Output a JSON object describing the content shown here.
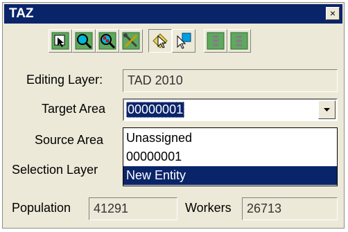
{
  "window": {
    "title": "TAZ",
    "close_symbol": "×"
  },
  "toolbar": {
    "buttons": [
      {
        "icon": "select-feature-icon"
      },
      {
        "icon": "zoom-in-icon"
      },
      {
        "icon": "zoom-layer-icon"
      },
      {
        "icon": "settings-tools-icon"
      },
      {
        "icon": "pointer-select-icon",
        "pressed": true
      },
      {
        "icon": "arrow-select-icon"
      },
      {
        "icon": "stack-up-icon"
      },
      {
        "icon": "stack-down-icon"
      }
    ]
  },
  "form": {
    "editing_layer_label": "Editing Layer:",
    "editing_layer_value": "TAD 2010",
    "target_area_label": "Target Area",
    "target_area_value": "00000001",
    "source_area_label": "Source Area",
    "selection_layer_label": "Selection Layer",
    "dropdown_options": [
      "Unassigned",
      "00000001",
      "New Entity"
    ],
    "dropdown_selected": "New Entity",
    "population_label": "Population",
    "population_value": "41291",
    "workers_label": "Workers",
    "workers_value": "26713"
  },
  "colors": {
    "titlebar": "#0a246a",
    "panel": "#ece9d8",
    "selection": "#0a246a",
    "icon_green": "#5fa85f",
    "icon_cyan": "#00b4d8"
  }
}
